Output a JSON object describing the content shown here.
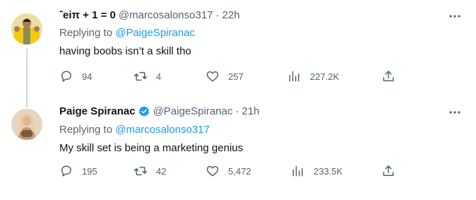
{
  "tweets": [
    {
      "display_name": "ˆeiπ + 1 = 0",
      "handle": "@marcosalonso317",
      "separator": "·",
      "time": "22h",
      "replying_prefix": "Replying to ",
      "replying_to": "@PaigeSpiranac",
      "text": "having boobs isn’t a skill tho",
      "replies": "94",
      "retweets": "4",
      "likes": "257",
      "views": "227.2K",
      "verified": false
    },
    {
      "display_name": "Paige Spiranac",
      "handle": "@PaigeSpiranac",
      "separator": "·",
      "time": "21h",
      "replying_prefix": "Replying to ",
      "replying_to": "@marcosalonso317",
      "text": "My skill set is being a marketing genius",
      "replies": "195",
      "retweets": "42",
      "likes": "5,472",
      "views": "233.5K",
      "verified": true
    }
  ],
  "icons": [
    "reply-icon",
    "retweet-icon",
    "like-icon",
    "views-icon",
    "share-icon",
    "more-icon",
    "verified-badge-icon"
  ],
  "colors": {
    "text": "#0f1419",
    "secondary": "#536471",
    "link": "#1d9bf0",
    "thread_line": "#cfd9de",
    "verified": "#1d9bf0"
  }
}
